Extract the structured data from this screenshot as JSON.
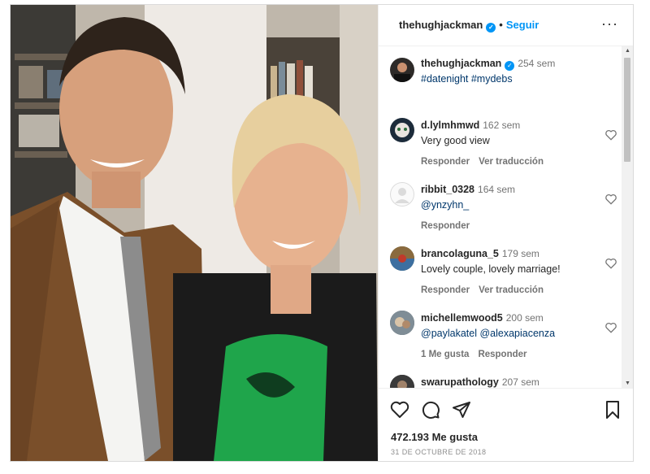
{
  "post": {
    "header": {
      "username": "thehughjackman",
      "separator": "•",
      "follow_label": "Seguir",
      "more_label": "···"
    },
    "caption": {
      "username": "thehughjackman",
      "time": "254 sem",
      "text": "#datenight #mydebs"
    },
    "comments": [
      {
        "username": "d.lylmhmwd",
        "time": "162 sem",
        "text": "Very good view",
        "actions": [
          "Responder",
          "Ver traducción"
        ]
      },
      {
        "username": "ribbit_0328",
        "time": "164 sem",
        "text": "@ynzyhn_",
        "actions": [
          "Responder"
        ]
      },
      {
        "username": "brancolaguna_5",
        "time": "179 sem",
        "text": "Lovely couple, lovely marriage!",
        "actions": [
          "Responder",
          "Ver traducción"
        ]
      },
      {
        "username": "michellemwood5",
        "time": "200 sem",
        "text": "@paylakatel @alexapiacenza",
        "actions": [
          "1 Me gusta",
          "Responder"
        ]
      },
      {
        "username": "swarupathology",
        "time": "207 sem",
        "text": "",
        "actions": []
      }
    ],
    "footer": {
      "likes": "472.193 Me gusta",
      "date": "31 DE OCTUBRE DE 2018"
    },
    "colors": {
      "accent": "#0095f6",
      "text": "#262626",
      "muted": "#737373"
    },
    "icons": [
      "verified-badge-icon",
      "more-icon",
      "heart-icon",
      "comment-icon",
      "share-icon",
      "save-icon"
    ]
  }
}
